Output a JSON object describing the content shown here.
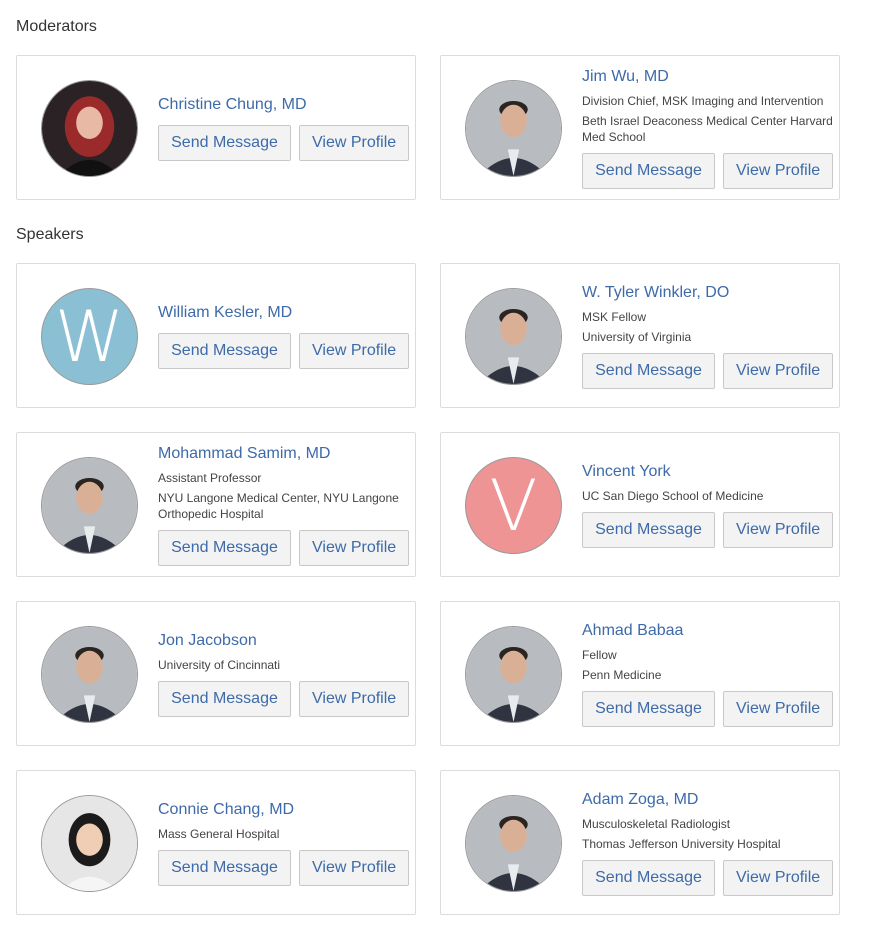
{
  "sections": {
    "moderators": "Moderators",
    "speakers": "Speakers"
  },
  "buttons": {
    "send": "Send Message",
    "view": "View Profile"
  },
  "people": [
    {
      "name": "Christine Chung, MD",
      "details": [],
      "avatar": "photo-woman-red-hair"
    },
    {
      "name": "Jim Wu, MD",
      "details": [
        "Division Chief, MSK Imaging and Intervention",
        "Beth Israel Deaconess Medical Center Harvard Med School"
      ],
      "avatar": "photo-man"
    },
    {
      "name": "William Kesler, MD",
      "details": [],
      "avatar": "letter",
      "letter": "W",
      "avatar_color": "#8bbfd3"
    },
    {
      "name": "W. Tyler Winkler, DO",
      "details": [
        "MSK Fellow",
        "University of Virginia"
      ],
      "avatar": "photo-man"
    },
    {
      "name": "Mohammad Samim, MD",
      "details": [
        "Assistant Professor",
        "NYU Langone Medical Center, NYU Langone Orthopedic Hospital"
      ],
      "avatar": "photo-man"
    },
    {
      "name": "Vincent York",
      "details": [
        "UC San Diego School of Medicine"
      ],
      "avatar": "letter",
      "letter": "V",
      "avatar_color": "#ee9494"
    },
    {
      "name": "Jon Jacobson",
      "details": [
        "University of Cincinnati"
      ],
      "avatar": "photo-man"
    },
    {
      "name": "Ahmad Babaa",
      "details": [
        "Fellow",
        "Penn Medicine"
      ],
      "avatar": "photo-man"
    },
    {
      "name": "Connie Chang, MD",
      "details": [
        "Mass General Hospital"
      ],
      "avatar": "photo-woman"
    },
    {
      "name": "Adam Zoga, MD",
      "details": [
        "Musculoskeletal Radiologist",
        "Thomas Jefferson University Hospital"
      ],
      "avatar": "photo-man"
    }
  ],
  "colors": {
    "link": "#3d6aa8",
    "button_bg": "#f3f3f3",
    "card_border": "#dcdcdc"
  }
}
